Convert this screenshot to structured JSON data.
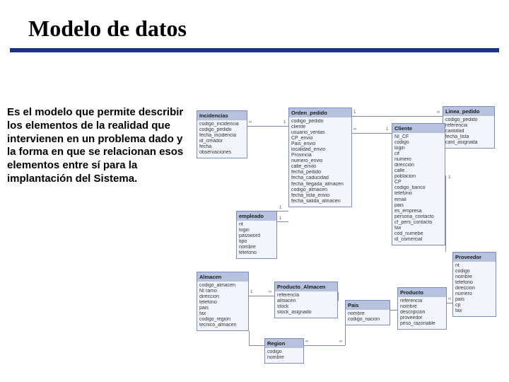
{
  "title": "Modelo de datos",
  "description": "Es el modelo que permite describir los elementos de la realidad que intervienen en un problema dado y la forma en que se relacionan esos elementos entre sí para la implantación del Sistema.",
  "entities": {
    "incidencias": {
      "name": "Incidencias",
      "fields": [
        "codigo_incidencia",
        "codigo_pedido",
        "fecha_incidencia",
        "id_creador",
        "fecha",
        "observaciones"
      ]
    },
    "orden_pedido": {
      "name": "Orden_pedido",
      "fields": [
        "codigo_pedido",
        "cliente",
        "usuario_ventas",
        "CP_envio",
        "Pais_envio",
        "localidad_envio",
        "Provincia",
        "numero_envio",
        "calle_envio",
        "fecha_pedido",
        "fecha_caducidad",
        "fecha_llegada_almacen",
        "codigo_almacen",
        "fecha_lista_envio",
        "fecha_salida_almacen"
      ]
    },
    "linea_pedido": {
      "name": "Linea_pedido",
      "fields": [
        "codigo_pedido",
        "referencia",
        "cantidad",
        "fecha_lista",
        "cant_asignada"
      ]
    },
    "cliente": {
      "name": "Cliente",
      "fields": [
        "NI_CF",
        "codigo",
        "login",
        "cif",
        "numero",
        "direccion",
        "calle",
        "poblacion",
        "CP",
        "codigo_banco",
        "telefono",
        "email",
        "pais",
        "es_empresa",
        "persona_contacto",
        "cf_pers_contacto",
        "fax",
        "cod_numebe",
        "id_comercial"
      ]
    },
    "empleado": {
      "name": "empleado",
      "fields": [
        "nt",
        "login",
        "password",
        "tipo",
        "nombre",
        "telefono"
      ]
    },
    "almacen": {
      "name": "Almacen",
      "fields": [
        "codigo_almacen",
        "NI ramo",
        "direccion",
        "telefono",
        "pais",
        "fax",
        "codigo_region",
        "tecnico_almacen"
      ]
    },
    "producto_almacen": {
      "name": "Producto_Almacen",
      "fields": [
        "referencia",
        "almacen",
        "stock",
        "stock_asignado"
      ]
    },
    "pais": {
      "name": "Pais",
      "fields": [
        "nombre",
        "codigo_nacion"
      ]
    },
    "producto": {
      "name": "Producto",
      "fields": [
        "referencia",
        "nombre",
        "descripcion",
        "proveedor",
        "peso_razonable"
      ]
    },
    "region": {
      "name": "Region",
      "fields": [
        "codigo",
        "nombre"
      ]
    },
    "proveedor": {
      "name": "Proveedor",
      "fields": [
        "nt",
        "codigo",
        "nombre",
        "telefono",
        "direccion",
        "numero",
        "pais",
        "cp",
        "fax"
      ]
    }
  },
  "cards": [
    "1",
    "∞"
  ]
}
